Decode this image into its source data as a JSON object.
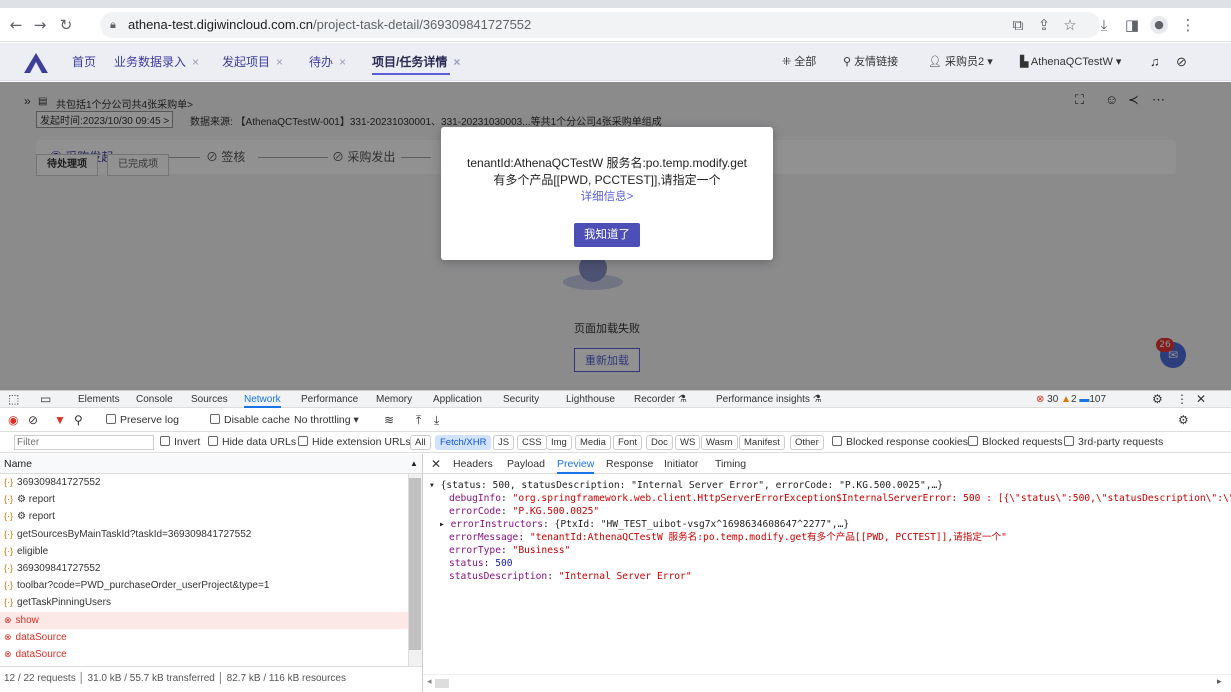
{
  "browser": {
    "url_host": "athena-test.digiwincloud.com.cn",
    "url_path": "/project-task-detail/369309841727552"
  },
  "app": {
    "tabs": [
      {
        "label": "首页"
      },
      {
        "label": "业务数据录入"
      },
      {
        "label": "发起项目"
      },
      {
        "label": "待办"
      },
      {
        "label": "项目/任务详情"
      }
    ],
    "all_label": "全部",
    "links_label": "友情链接",
    "user_label": "采购员2 ▾",
    "tenant_label": "AthenaQCTestW ▾"
  },
  "page": {
    "title": "共包括1个分公司共4张采购单>",
    "meta_tag": "发起时间:2023/10/30 09:45 >",
    "meta_source": "数据来源: 【AthenaQCTestW-001】331-20231030001、331-20231030003...等共1个分公司4张采购单组成",
    "steps": [
      "采购发起",
      "签核",
      "采购发出"
    ],
    "subtabs": [
      "待处理项",
      "已完成项"
    ],
    "load_failed": "页面加载失败",
    "reload_button": "重新加载",
    "chat_badge": "26"
  },
  "modal": {
    "line1": "tenantId:AthenaQCTestW 服务名:po.temp.modify.get",
    "line2": "有多个产品[[PWD, PCCTEST]],请指定一个",
    "detail_link": "详细信息>",
    "ok_button": "我知道了"
  },
  "devtools": {
    "tabs": [
      "Elements",
      "Console",
      "Sources",
      "Network",
      "Performance",
      "Memory",
      "Application",
      "Security",
      "Lighthouse",
      "Recorder",
      "Performance insights"
    ],
    "errors": "30",
    "warnings": "2",
    "messages": "107",
    "toolbar": {
      "preserve_log": "Preserve log",
      "disable_cache": "Disable cache",
      "throttling": "No throttling"
    },
    "filter": {
      "placeholder": "Filter",
      "invert": "Invert",
      "hide_data": "Hide data URLs",
      "hide_ext": "Hide extension URLs",
      "chips": [
        "All",
        "Fetch/XHR",
        "JS",
        "CSS",
        "Img",
        "Media",
        "Font",
        "Doc",
        "WS",
        "Wasm",
        "Manifest",
        "Other"
      ],
      "blocked_cookies": "Blocked response cookies",
      "blocked_requests": "Blocked requests",
      "third_party": "3rd-party requests"
    },
    "name_header": "Name",
    "requests": [
      {
        "name": "369309841727552",
        "error": false
      },
      {
        "name": "⚙ report",
        "error": false
      },
      {
        "name": "⚙ report",
        "error": false
      },
      {
        "name": "getSourcesByMainTaskId?taskId=369309841727552",
        "error": false
      },
      {
        "name": "eligible",
        "error": false
      },
      {
        "name": "369309841727552",
        "error": false
      },
      {
        "name": "toolbar?code=PWD_purchaseOrder_userProject&type=1",
        "error": false
      },
      {
        "name": "getTaskPinningUsers",
        "error": false
      },
      {
        "name": "show",
        "error": true
      },
      {
        "name": "dataSource",
        "error": true
      },
      {
        "name": "dataSource",
        "error": true
      }
    ],
    "status": {
      "requests": "12 / 22 requests",
      "transferred": "31.0 kB / 55.7 kB transferred",
      "resources": "82.7 kB / 116 kB resources"
    },
    "detail_tabs": [
      "Headers",
      "Payload",
      "Preview",
      "Response",
      "Initiator",
      "Timing"
    ],
    "preview": {
      "summary": "{status: 500, statusDescription: \"Internal Server Error\", errorCode: \"P.KG.500.0025\",…}",
      "debugInfo_key": "debugInfo",
      "debugInfo_val": "\"org.springframework.web.client.HttpServerErrorException$InternalServerError: 500 : [{\\\"status\\\":500,\\\"statusDescription\\\":\\\"In",
      "errorCode_key": "errorCode",
      "errorCode_val": "\"P.KG.500.0025\"",
      "errorInstructors_key": "errorInstructors",
      "errorInstructors_val": "{PtxId: \"HW_TEST_uibot-vsg7x^1698634608647^2277\",…}",
      "errorMessage_key": "errorMessage",
      "errorMessage_val": "\"tenantId:AthenaQCTestW 服务名:po.temp.modify.get有多个产品[[PWD, PCCTEST]],请指定一个\"",
      "errorType_key": "errorType",
      "errorType_val": "\"Business\"",
      "status_key": "status",
      "status_val": "500",
      "statusDescription_key": "statusDescription",
      "statusDescription_val": "\"Internal Server Error\""
    }
  }
}
